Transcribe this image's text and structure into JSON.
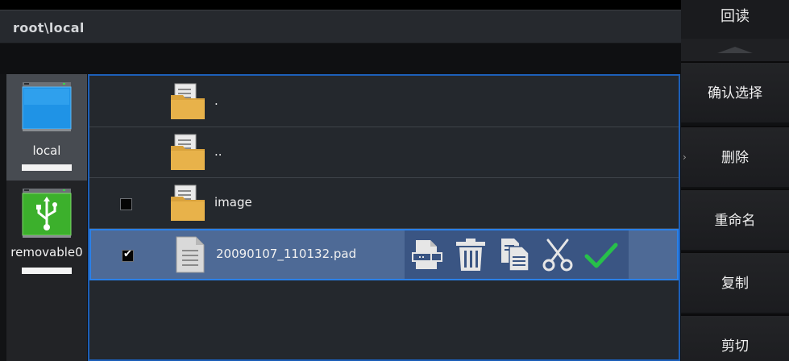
{
  "path": {
    "text": "root\\local"
  },
  "drives": [
    {
      "label": "local",
      "icon": "monitor-drive-icon",
      "selected": true
    },
    {
      "label": "removable0",
      "icon": "usb-drive-icon",
      "selected": false
    }
  ],
  "files": [
    {
      "name": ".",
      "type": "folder",
      "checkbox": false,
      "checked": false
    },
    {
      "name": "..",
      "type": "folder",
      "checkbox": false,
      "checked": false
    },
    {
      "name": "image",
      "type": "folder",
      "checkbox": true,
      "checked": false
    },
    {
      "name": "20090107_110132.pad",
      "type": "document",
      "checkbox": true,
      "checked": true,
      "selected": true
    }
  ],
  "row_actions": [
    "rename-icon",
    "delete-icon",
    "copy-icon",
    "cut-icon",
    "confirm-icon"
  ],
  "menu": {
    "title": "回读",
    "items": [
      "确认选择",
      "删除",
      "重命名",
      "复制",
      "剪切"
    ]
  },
  "colors": {
    "accent_border": "#1c5fb8",
    "selected_row": "#4e6a96",
    "confirm_green": "#27c04a",
    "folder": "#d9a23c"
  }
}
